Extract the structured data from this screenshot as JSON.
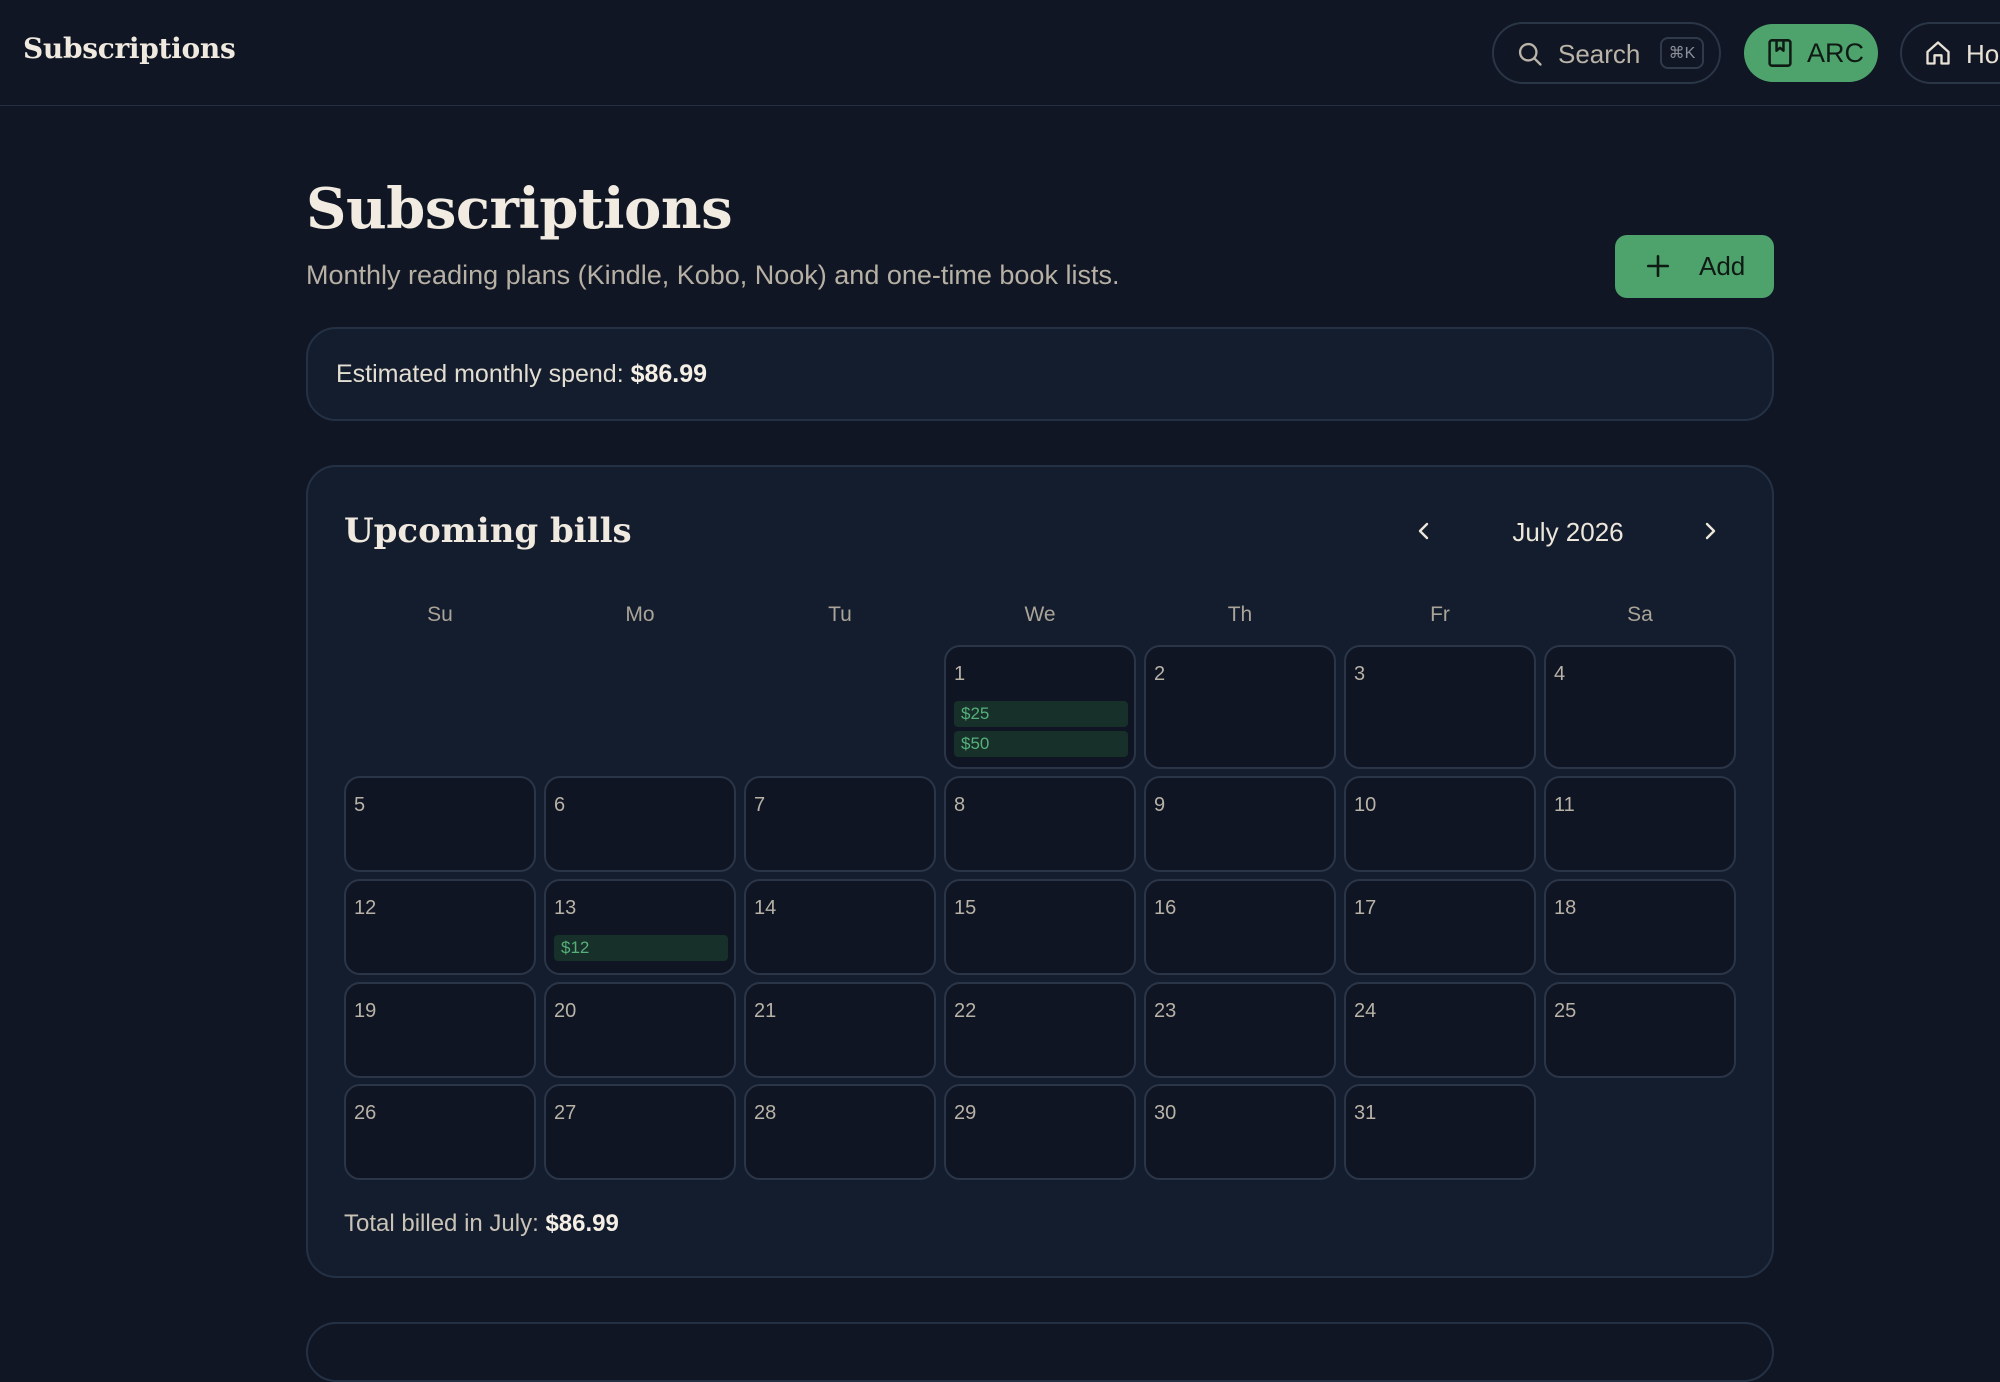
{
  "topbar": {
    "brand": "Subscriptions",
    "search_label": "Search",
    "search_shortcut": "⌘K",
    "arc_label": "ARC",
    "home_label": "Ho"
  },
  "header": {
    "title": "Subscriptions",
    "subtitle": "Monthly reading plans (Kindle, Kobo, Nook) and one-time book lists.",
    "add_label": "Add"
  },
  "spend": {
    "label": "Estimated monthly spend: ",
    "value": "$86.99"
  },
  "calendar": {
    "title": "Upcoming bills",
    "month": "July 2026",
    "weekdays": [
      "Su",
      "Mo",
      "Tu",
      "We",
      "Th",
      "Fr",
      "Sa"
    ],
    "first_weekday_index": 3,
    "days_in_month": 31,
    "bills": {
      "1": [
        "$25",
        "$50"
      ],
      "13": [
        "$12"
      ]
    },
    "total_label": "Total billed in July: ",
    "total_value": "$86.99"
  },
  "colors": {
    "background": "#101623",
    "card": "#141d2d",
    "accent": "#4ea36d",
    "bill_text": "#56b07a"
  }
}
